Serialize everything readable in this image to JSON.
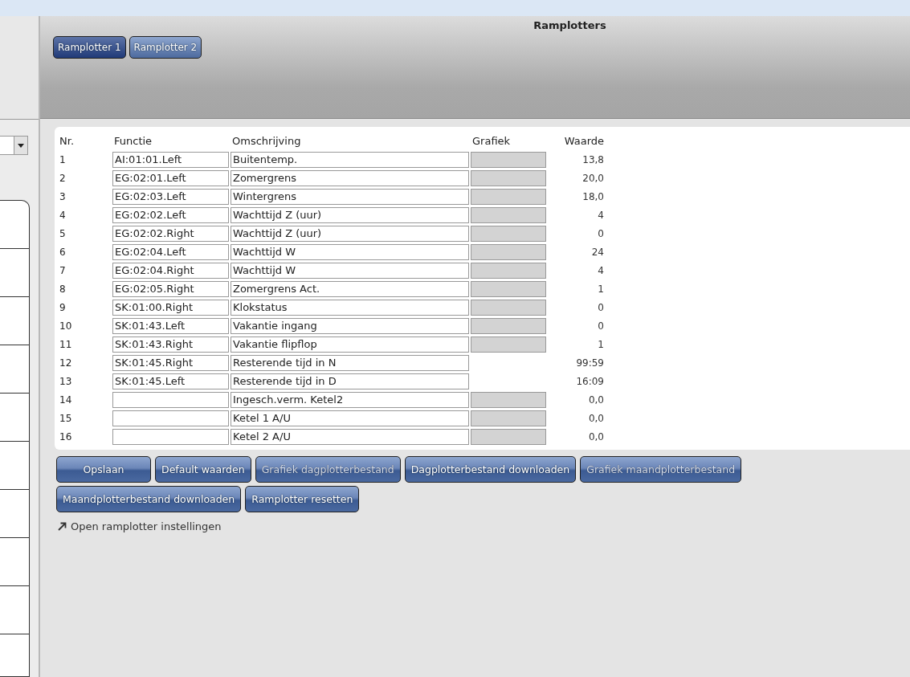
{
  "header": {
    "title": "Ramplotters"
  },
  "tabs": [
    {
      "label": "Ramplotter 1",
      "selected": true
    },
    {
      "label": "Ramplotter 2",
      "selected": false
    }
  ],
  "table": {
    "columns": [
      "Nr.",
      "Functie",
      "Omschrijving",
      "Grafiek",
      "Waarde"
    ],
    "rows": [
      {
        "nr": "1",
        "function": "AI:01:01.Left",
        "description": "Buitentemp.",
        "graph": true,
        "value": "13,8"
      },
      {
        "nr": "2",
        "function": "EG:02:01.Left",
        "description": "Zomergrens",
        "graph": true,
        "value": "20,0"
      },
      {
        "nr": "3",
        "function": "EG:02:03.Left",
        "description": "Wintergrens",
        "graph": true,
        "value": "18,0"
      },
      {
        "nr": "4",
        "function": "EG:02:02.Left",
        "description": "Wachttijd Z (uur)",
        "graph": true,
        "value": "4"
      },
      {
        "nr": "5",
        "function": "EG:02:02.Right",
        "description": "Wachttijd Z (uur)",
        "graph": true,
        "value": "0"
      },
      {
        "nr": "6",
        "function": "EG:02:04.Left",
        "description": "Wachttijd W",
        "graph": true,
        "value": "24"
      },
      {
        "nr": "7",
        "function": "EG:02:04.Right",
        "description": "Wachttijd W",
        "graph": true,
        "value": "4"
      },
      {
        "nr": "8",
        "function": "EG:02:05.Right",
        "description": "Zomergrens Act.",
        "graph": true,
        "value": "1"
      },
      {
        "nr": "9",
        "function": "SK:01:00.Right",
        "description": "Klokstatus",
        "graph": true,
        "value": "0"
      },
      {
        "nr": "10",
        "function": "SK:01:43.Left",
        "description": "Vakantie ingang",
        "graph": true,
        "value": "0"
      },
      {
        "nr": "11",
        "function": "SK:01:43.Right",
        "description": "Vakantie flipflop",
        "graph": true,
        "value": "1"
      },
      {
        "nr": "12",
        "function": "SK:01:45.Right",
        "description": "Resterende tijd in N",
        "graph": false,
        "value": "99:59"
      },
      {
        "nr": "13",
        "function": "SK:01:45.Left",
        "description": "Resterende tijd in D",
        "graph": false,
        "value": "16:09"
      },
      {
        "nr": "14",
        "description": "Ingesch.verm. Ketel2",
        "graph": true,
        "value": "0,0"
      },
      {
        "nr": "15",
        "description": "Ketel 1 A/U",
        "graph": true,
        "value": "0,0"
      },
      {
        "nr": "16",
        "description": "Ketel 2 A/U",
        "graph": true,
        "value": "0,0"
      }
    ]
  },
  "buttons": [
    {
      "label": "Opslaan",
      "disabled": false
    },
    {
      "label": "Default waarden",
      "disabled": false
    },
    {
      "label": "Grafiek dagplotterbestand",
      "disabled": true
    },
    {
      "label": "Dagplotterbestand downloaden",
      "disabled": false
    },
    {
      "label": "Grafiek maandplotterbestand",
      "disabled": true
    },
    {
      "label": "Maandplotterbestand downloaden",
      "disabled": false
    },
    {
      "label": "Ramplotter resetten",
      "disabled": false
    }
  ],
  "link": {
    "label": "Open ramplotter instellingen"
  }
}
